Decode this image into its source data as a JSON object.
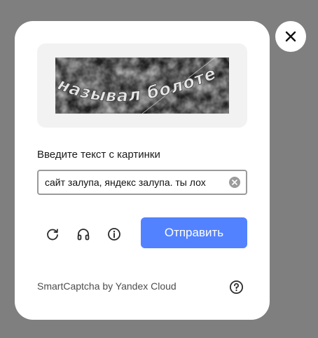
{
  "close": {
    "icon": "close-icon"
  },
  "captcha": {
    "image_text": "называл болоте",
    "prompt": "Введите текст с картинки",
    "input_value": "сайт залупа, яндекс залупа. ты лох",
    "clear_icon": "clear-icon"
  },
  "toolbar": {
    "refresh_icon": "refresh-icon",
    "audio_icon": "headphones-icon",
    "info_icon": "info-icon",
    "submit_label": "Отправить"
  },
  "footer": {
    "brand": "SmartCaptcha by Yandex Cloud",
    "help_icon": "help-icon"
  },
  "colors": {
    "backdrop": "#7f7f7f",
    "card": "#ffffff",
    "accent": "#5282ff",
    "image_well": "#f2f2f2"
  }
}
